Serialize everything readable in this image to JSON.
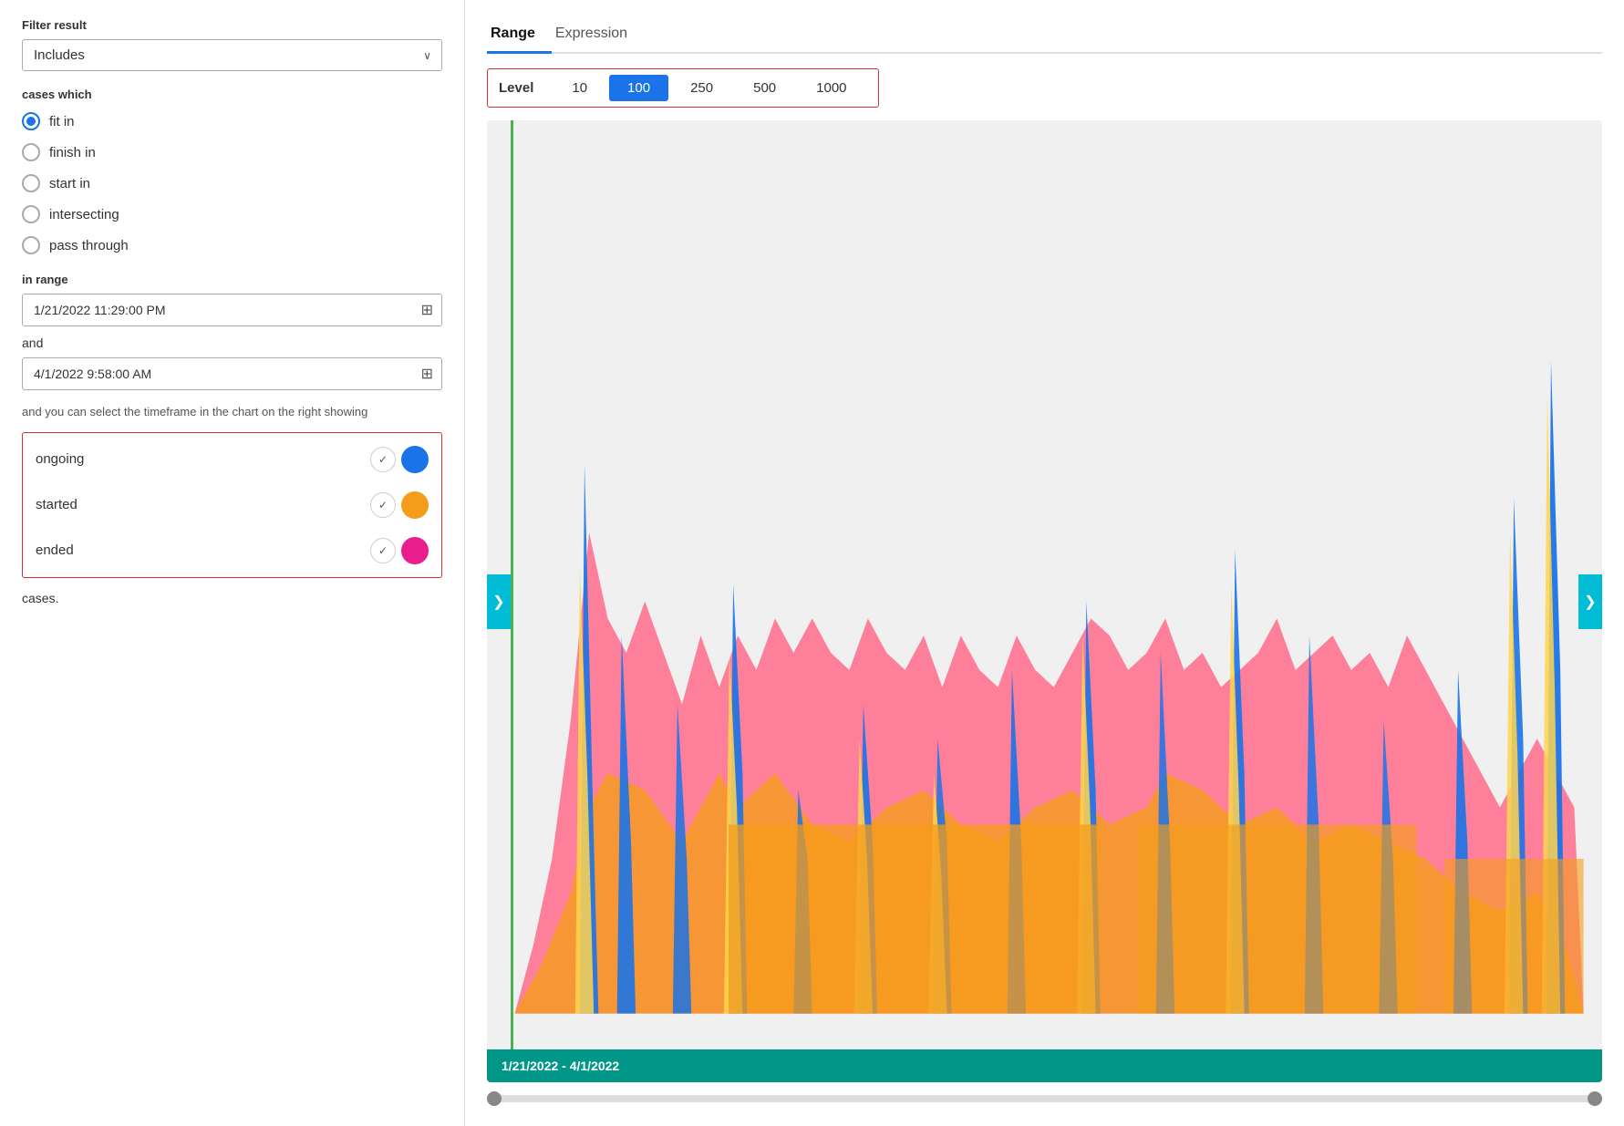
{
  "left": {
    "filter_result_label": "Filter result",
    "dropdown_value": "Includes",
    "cases_which_label": "cases which",
    "radio_options": [
      {
        "id": "fit-in",
        "label": "fit in",
        "selected": true
      },
      {
        "id": "finish-in",
        "label": "finish in",
        "selected": false
      },
      {
        "id": "start-in",
        "label": "start in",
        "selected": false
      },
      {
        "id": "intersecting",
        "label": "intersecting",
        "selected": false
      },
      {
        "id": "pass-through",
        "label": "pass through",
        "selected": false
      }
    ],
    "in_range_label": "in range",
    "date_start": "1/21/2022 11:29:00 PM",
    "date_end": "4/1/2022 9:58:00 AM",
    "and_label": "and",
    "helper_text": "and you can select the timeframe in the chart on the right showing",
    "toggles": [
      {
        "label": "ongoing",
        "dot_class": "dot-blue",
        "check": "✓"
      },
      {
        "label": "started",
        "dot_class": "dot-orange",
        "check": "✓"
      },
      {
        "label": "ended",
        "dot_class": "dot-pink",
        "check": "✓"
      }
    ],
    "cases_suffix": "cases."
  },
  "right": {
    "tabs": [
      {
        "label": "Range",
        "active": true
      },
      {
        "label": "Expression",
        "active": false
      }
    ],
    "level_label": "Level",
    "level_options": [
      {
        "value": "10",
        "active": false
      },
      {
        "value": "100",
        "active": true
      },
      {
        "value": "250",
        "active": false
      },
      {
        "value": "500",
        "active": false
      },
      {
        "value": "1000",
        "active": false
      }
    ],
    "chart_date_range": "1/21/2022 - 4/1/2022",
    "nav_left_icon": "❯",
    "nav_right_icon": "❯"
  },
  "icons": {
    "dropdown_arrow": "∨",
    "calendar": "⊞",
    "check": "✓"
  }
}
